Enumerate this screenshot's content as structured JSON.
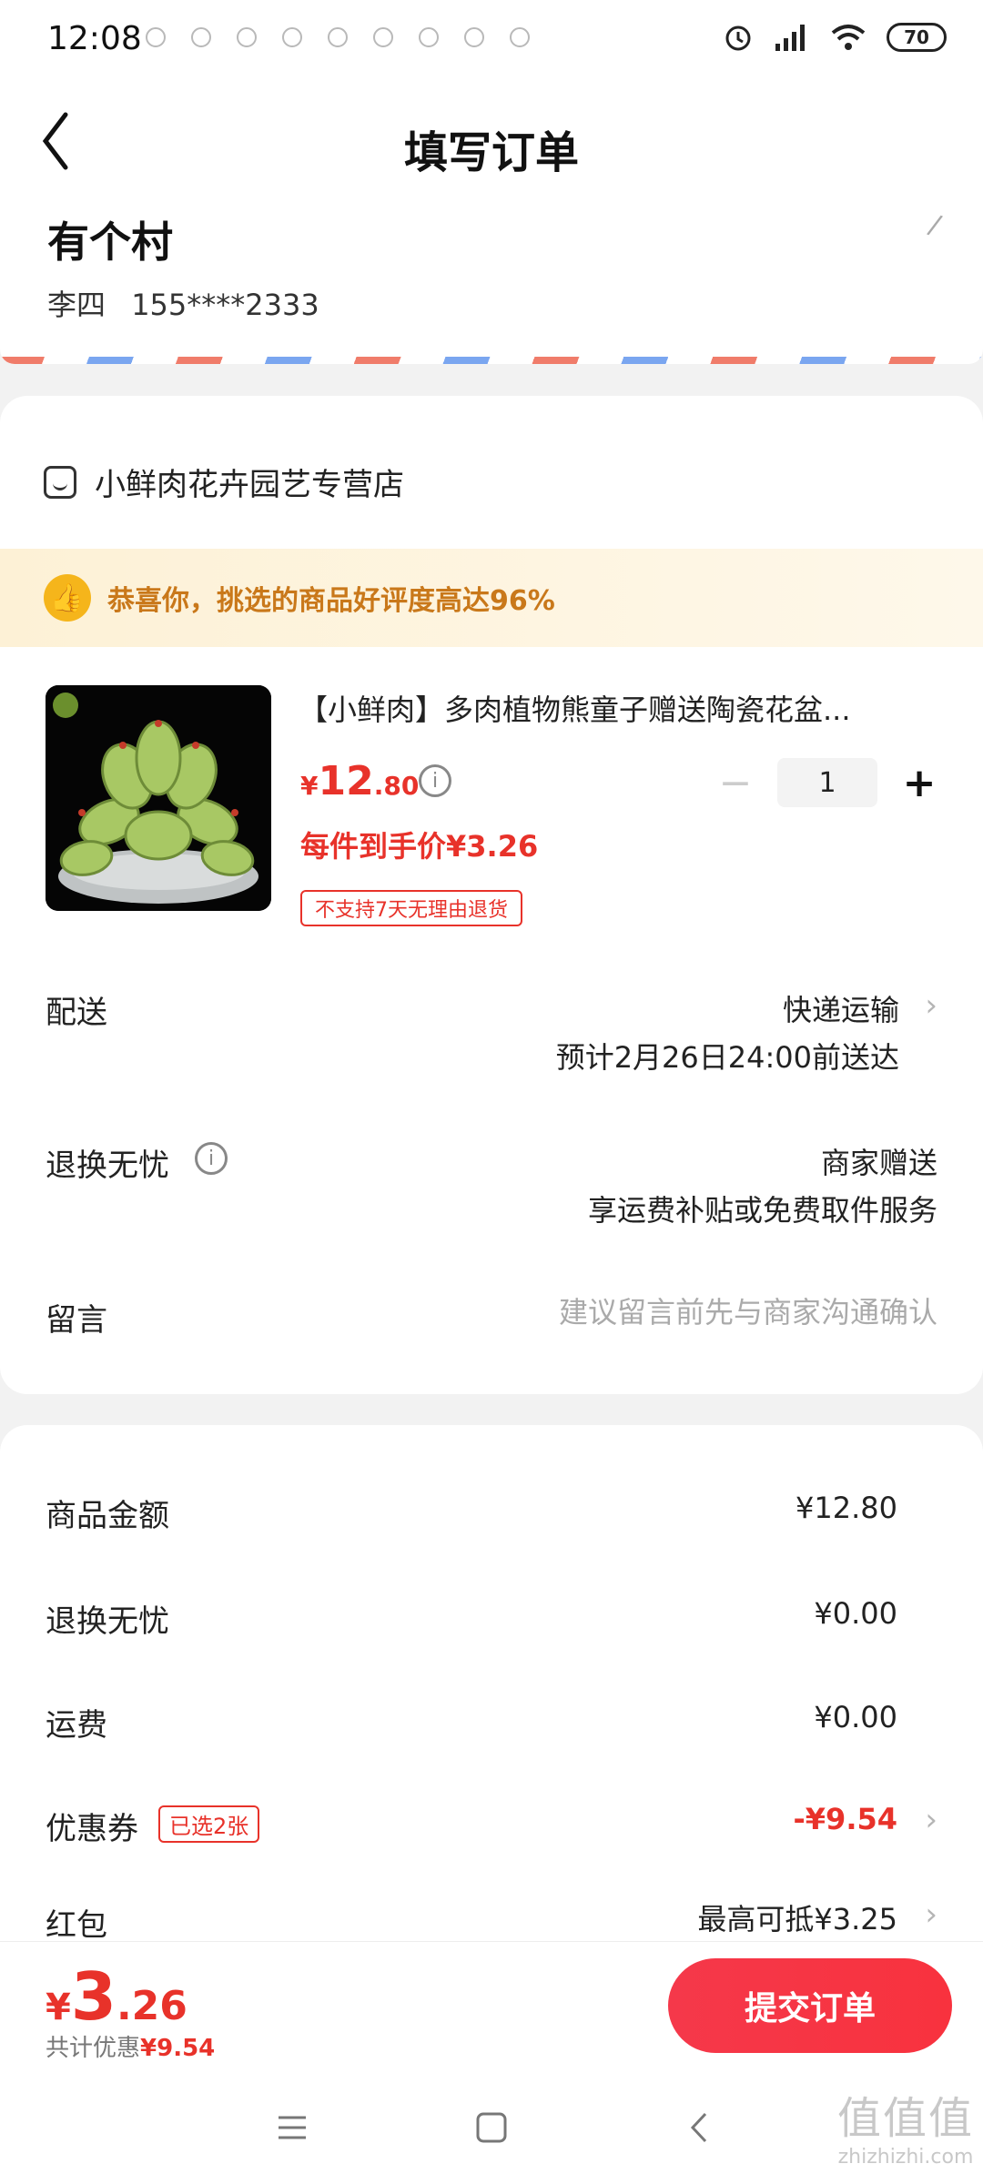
{
  "status_bar": {
    "time": "12:08",
    "battery": "70"
  },
  "nav": {
    "title": "填写订单"
  },
  "address": {
    "name": "有个村",
    "recipient": "李四",
    "phone": "155****2333"
  },
  "store": {
    "name": "小鲜肉花卉园艺专营店"
  },
  "banner": {
    "text": "恭喜你，挑选的商品好评度高达96%"
  },
  "product": {
    "title": "【小鲜肉】多肉植物熊童子赠送陶瓷花盆...",
    "price_currency": "¥",
    "price_int": "12",
    "price_dec": ".80",
    "unit_price": "每件到手价¥3.26",
    "no_return_tag": "不支持7天无理由退货",
    "quantity": "1",
    "minus_label": "−",
    "plus_label": "+"
  },
  "delivery": {
    "label": "配送",
    "method": "快递运输",
    "eta": "预计2月26日24:00前送达"
  },
  "return_worry_free": {
    "label": "退换无忧",
    "value": "商家赠送",
    "desc": "享运费补贴或免费取件服务"
  },
  "remark": {
    "label": "留言",
    "placeholder": "建议留言前先与商家沟通确认"
  },
  "summary": {
    "goods_amount_label": "商品金额",
    "goods_amount": "¥12.80",
    "return_label": "退换无忧",
    "return_amount": "¥0.00",
    "shipping_label": "运费",
    "shipping_amount": "¥0.00",
    "coupon_label": "优惠券",
    "coupon_tag": "已选2张",
    "coupon_amount": "-¥9.54",
    "redpacket_label": "红包",
    "redpacket_value": "最高可抵¥3.25"
  },
  "bottom": {
    "total_currency": "¥",
    "total_int": "3",
    "total_dec": ".26",
    "saving_label": "共计优惠",
    "saving_amount": "¥9.54",
    "submit_label": "提交订单"
  },
  "watermark": {
    "line1": "值值值",
    "line2": "zhizhizhi.com"
  }
}
